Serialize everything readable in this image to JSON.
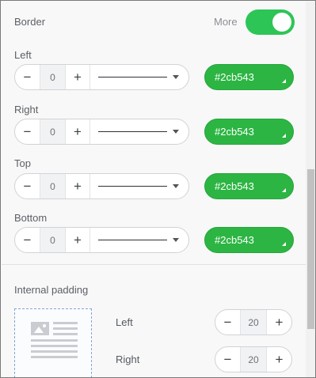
{
  "border": {
    "title": "Border",
    "more_label": "More",
    "more_enabled": true,
    "accent_color": "#2cc556",
    "rows": [
      {
        "label": "Left",
        "width": "0",
        "color_label": "#2cb543",
        "line_style": "solid"
      },
      {
        "label": "Right",
        "width": "0",
        "color_label": "#2cb543",
        "line_style": "solid"
      },
      {
        "label": "Top",
        "width": "0",
        "color_label": "#2cb543",
        "line_style": "solid"
      },
      {
        "label": "Bottom",
        "width": "0",
        "color_label": "#2cb543",
        "line_style": "solid"
      }
    ],
    "minus_symbol": "−",
    "plus_symbol": "+"
  },
  "padding": {
    "title": "Internal padding",
    "left_label": "Left",
    "left_value": "20",
    "right_label": "Right",
    "right_value": "20"
  }
}
